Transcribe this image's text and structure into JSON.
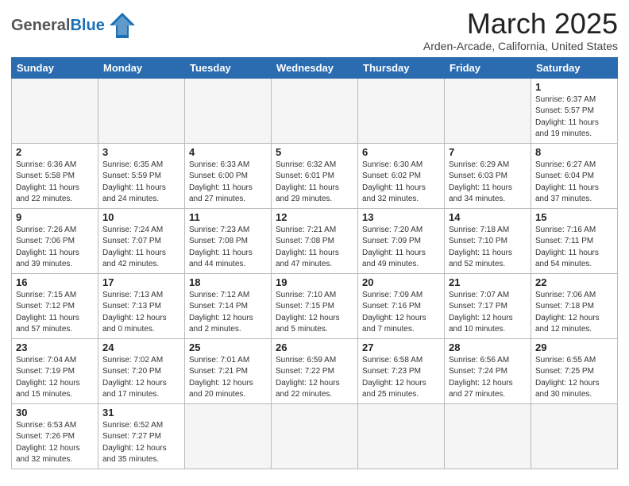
{
  "header": {
    "logo_general": "General",
    "logo_blue": "Blue",
    "month_title": "March 2025",
    "location": "Arden-Arcade, California, United States"
  },
  "weekdays": [
    "Sunday",
    "Monday",
    "Tuesday",
    "Wednesday",
    "Thursday",
    "Friday",
    "Saturday"
  ],
  "weeks": [
    [
      {
        "day": "",
        "info": ""
      },
      {
        "day": "",
        "info": ""
      },
      {
        "day": "",
        "info": ""
      },
      {
        "day": "",
        "info": ""
      },
      {
        "day": "",
        "info": ""
      },
      {
        "day": "",
        "info": ""
      },
      {
        "day": "1",
        "info": "Sunrise: 6:37 AM\nSunset: 5:57 PM\nDaylight: 11 hours\nand 19 minutes."
      }
    ],
    [
      {
        "day": "2",
        "info": "Sunrise: 6:36 AM\nSunset: 5:58 PM\nDaylight: 11 hours\nand 22 minutes."
      },
      {
        "day": "3",
        "info": "Sunrise: 6:35 AM\nSunset: 5:59 PM\nDaylight: 11 hours\nand 24 minutes."
      },
      {
        "day": "4",
        "info": "Sunrise: 6:33 AM\nSunset: 6:00 PM\nDaylight: 11 hours\nand 27 minutes."
      },
      {
        "day": "5",
        "info": "Sunrise: 6:32 AM\nSunset: 6:01 PM\nDaylight: 11 hours\nand 29 minutes."
      },
      {
        "day": "6",
        "info": "Sunrise: 6:30 AM\nSunset: 6:02 PM\nDaylight: 11 hours\nand 32 minutes."
      },
      {
        "day": "7",
        "info": "Sunrise: 6:29 AM\nSunset: 6:03 PM\nDaylight: 11 hours\nand 34 minutes."
      },
      {
        "day": "8",
        "info": "Sunrise: 6:27 AM\nSunset: 6:04 PM\nDaylight: 11 hours\nand 37 minutes."
      }
    ],
    [
      {
        "day": "9",
        "info": "Sunrise: 7:26 AM\nSunset: 7:06 PM\nDaylight: 11 hours\nand 39 minutes."
      },
      {
        "day": "10",
        "info": "Sunrise: 7:24 AM\nSunset: 7:07 PM\nDaylight: 11 hours\nand 42 minutes."
      },
      {
        "day": "11",
        "info": "Sunrise: 7:23 AM\nSunset: 7:08 PM\nDaylight: 11 hours\nand 44 minutes."
      },
      {
        "day": "12",
        "info": "Sunrise: 7:21 AM\nSunset: 7:08 PM\nDaylight: 11 hours\nand 47 minutes."
      },
      {
        "day": "13",
        "info": "Sunrise: 7:20 AM\nSunset: 7:09 PM\nDaylight: 11 hours\nand 49 minutes."
      },
      {
        "day": "14",
        "info": "Sunrise: 7:18 AM\nSunset: 7:10 PM\nDaylight: 11 hours\nand 52 minutes."
      },
      {
        "day": "15",
        "info": "Sunrise: 7:16 AM\nSunset: 7:11 PM\nDaylight: 11 hours\nand 54 minutes."
      }
    ],
    [
      {
        "day": "16",
        "info": "Sunrise: 7:15 AM\nSunset: 7:12 PM\nDaylight: 11 hours\nand 57 minutes."
      },
      {
        "day": "17",
        "info": "Sunrise: 7:13 AM\nSunset: 7:13 PM\nDaylight: 12 hours\nand 0 minutes."
      },
      {
        "day": "18",
        "info": "Sunrise: 7:12 AM\nSunset: 7:14 PM\nDaylight: 12 hours\nand 2 minutes."
      },
      {
        "day": "19",
        "info": "Sunrise: 7:10 AM\nSunset: 7:15 PM\nDaylight: 12 hours\nand 5 minutes."
      },
      {
        "day": "20",
        "info": "Sunrise: 7:09 AM\nSunset: 7:16 PM\nDaylight: 12 hours\nand 7 minutes."
      },
      {
        "day": "21",
        "info": "Sunrise: 7:07 AM\nSunset: 7:17 PM\nDaylight: 12 hours\nand 10 minutes."
      },
      {
        "day": "22",
        "info": "Sunrise: 7:06 AM\nSunset: 7:18 PM\nDaylight: 12 hours\nand 12 minutes."
      }
    ],
    [
      {
        "day": "23",
        "info": "Sunrise: 7:04 AM\nSunset: 7:19 PM\nDaylight: 12 hours\nand 15 minutes."
      },
      {
        "day": "24",
        "info": "Sunrise: 7:02 AM\nSunset: 7:20 PM\nDaylight: 12 hours\nand 17 minutes."
      },
      {
        "day": "25",
        "info": "Sunrise: 7:01 AM\nSunset: 7:21 PM\nDaylight: 12 hours\nand 20 minutes."
      },
      {
        "day": "26",
        "info": "Sunrise: 6:59 AM\nSunset: 7:22 PM\nDaylight: 12 hours\nand 22 minutes."
      },
      {
        "day": "27",
        "info": "Sunrise: 6:58 AM\nSunset: 7:23 PM\nDaylight: 12 hours\nand 25 minutes."
      },
      {
        "day": "28",
        "info": "Sunrise: 6:56 AM\nSunset: 7:24 PM\nDaylight: 12 hours\nand 27 minutes."
      },
      {
        "day": "29",
        "info": "Sunrise: 6:55 AM\nSunset: 7:25 PM\nDaylight: 12 hours\nand 30 minutes."
      }
    ],
    [
      {
        "day": "30",
        "info": "Sunrise: 6:53 AM\nSunset: 7:26 PM\nDaylight: 12 hours\nand 32 minutes."
      },
      {
        "day": "31",
        "info": "Sunrise: 6:52 AM\nSunset: 7:27 PM\nDaylight: 12 hours\nand 35 minutes."
      },
      {
        "day": "",
        "info": ""
      },
      {
        "day": "",
        "info": ""
      },
      {
        "day": "",
        "info": ""
      },
      {
        "day": "",
        "info": ""
      },
      {
        "day": "",
        "info": ""
      }
    ]
  ]
}
